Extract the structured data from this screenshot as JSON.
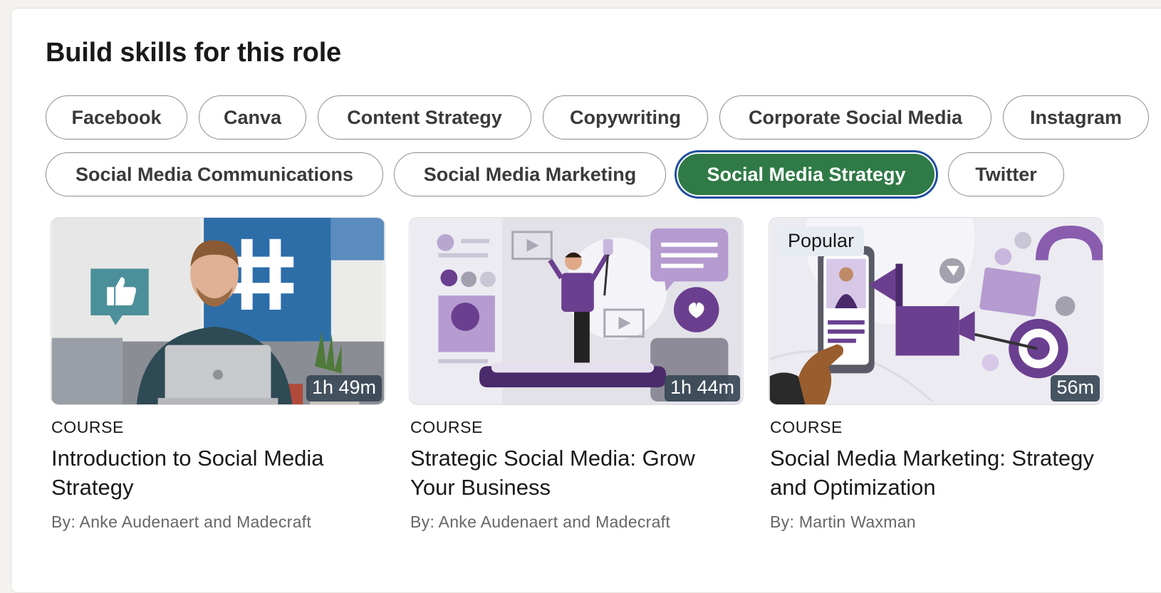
{
  "section": {
    "heading": "Build skills for this role"
  },
  "skills": [
    {
      "label": "Facebook",
      "selected": false
    },
    {
      "label": "Canva",
      "selected": false
    },
    {
      "label": "Content Strategy",
      "selected": false
    },
    {
      "label": "Copywriting",
      "selected": false
    },
    {
      "label": "Corporate Social Media",
      "selected": false
    },
    {
      "label": "Instagram",
      "selected": false
    },
    {
      "label": "Social Media Communications",
      "selected": false
    },
    {
      "label": "Social Media Marketing",
      "selected": false
    },
    {
      "label": "Social Media Strategy",
      "selected": true
    },
    {
      "label": "Twitter",
      "selected": false
    }
  ],
  "courses": [
    {
      "type": "COURSE",
      "title": "Introduction to Social Media Strategy",
      "author": "By: Anke Audenaert and Madecraft",
      "duration": "1h 49m",
      "badge": ""
    },
    {
      "type": "COURSE",
      "title": "Strategic Social Media: Grow Your Business",
      "author": "By: Anke Audenaert and Madecraft",
      "duration": "1h 44m",
      "badge": ""
    },
    {
      "type": "COURSE",
      "title": "Social Media Marketing: Strategy and Optimization",
      "author": "By: Martin Waxman",
      "duration": "56m",
      "badge": "Popular"
    }
  ],
  "colors": {
    "selected_pill": "#2f7a46",
    "focus_ring": "#1f4e9e",
    "accent_purple": "#6b3f8f"
  }
}
